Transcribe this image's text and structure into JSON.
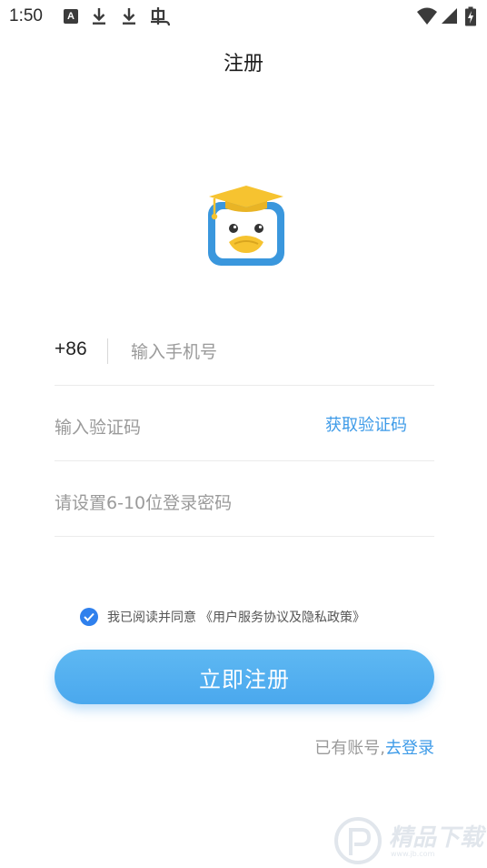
{
  "status_bar": {
    "time": "1:50",
    "notification_letter": "A",
    "icons": [
      "a-notification-icon",
      "download-icon",
      "download-icon",
      "bug-icon",
      "wifi-icon",
      "signal-icon",
      "battery-charging-icon"
    ]
  },
  "header": {
    "title": "注册"
  },
  "logo": {
    "icon": "duck-graduation-cap-logo-icon"
  },
  "form": {
    "country_code": "+86",
    "phone_placeholder": "输入手机号",
    "code_placeholder": "输入验证码",
    "get_code_label": "获取验证码",
    "password_placeholder": "请设置6-10位登录密码"
  },
  "agreement": {
    "checked": true,
    "text": "我已阅读并同意",
    "link": "《用户服务协议及隐私政策》"
  },
  "register_button": {
    "label": "立即注册"
  },
  "login_hint": {
    "prefix": "已有账号,",
    "link": "去登录"
  },
  "watermark": {
    "text": "精品下载",
    "url": "www.jb.com"
  },
  "colors": {
    "accent": "#3e9be8",
    "button": "#4aa8ee",
    "checkbox": "#2f80ed",
    "logo_blue": "#3a97dd",
    "logo_yellow": "#f6c330",
    "placeholder": "#9a9a9a"
  }
}
